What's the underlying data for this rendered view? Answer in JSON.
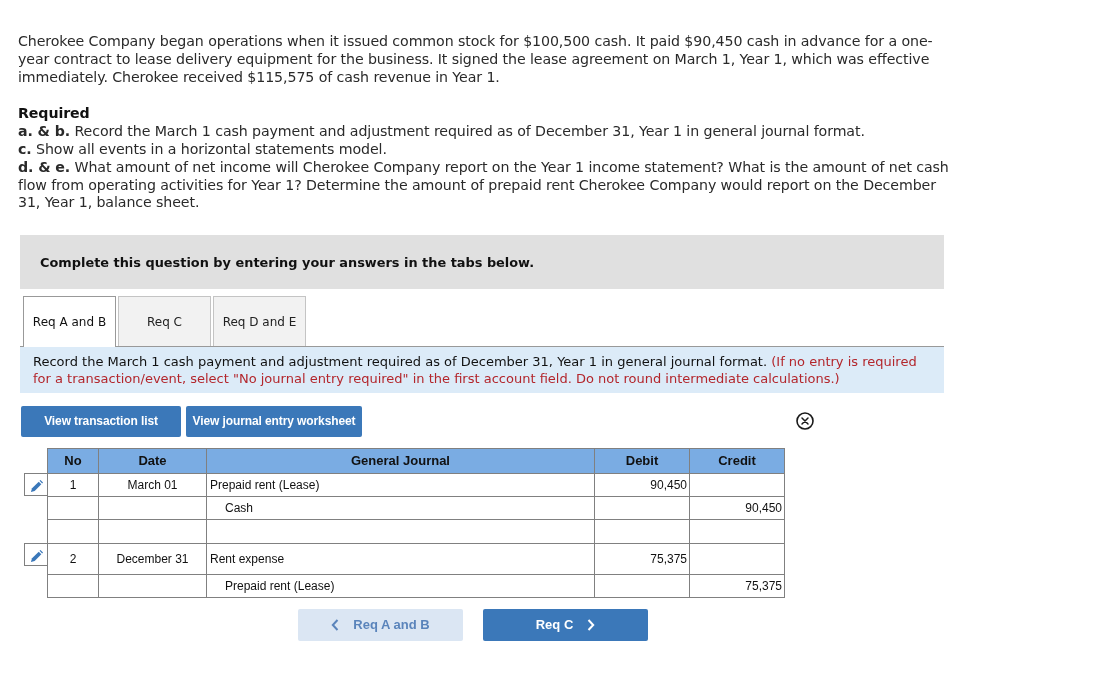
{
  "problem": {
    "intro": "Cherokee Company began operations when it issued common stock for $100,500 cash. It paid $90,450 cash in advance for a one-year contract to lease delivery equipment for the business. It signed the lease agreement on March 1, Year 1, which was effective immediately. Cherokee received $115,575 of cash revenue in Year 1.",
    "required_heading": "Required",
    "requirements": [
      "**a. & b.** Record the March 1 cash payment and adjustment required as of December 31, Year 1 in general journal format.",
      "**c.** Show all events in a horizontal statements model.",
      "**d. & e.** What amount of net income will Cherokee Company report on the Year 1 income statement? What is the amount of net cash flow from operating activities for Year 1? Determine the amount of prepaid rent Cherokee Company would report on the December 31, Year 1, balance sheet."
    ]
  },
  "banner": "Complete this question by entering your answers in the tabs below.",
  "tabs": [
    {
      "label": "Req A and B",
      "selected": true
    },
    {
      "label": "Req C",
      "selected": false
    },
    {
      "label": "Req D and E",
      "selected": false
    }
  ],
  "instructions": {
    "text": "Record the March 1 cash payment and adjustment required as of December 31, Year 1 in general journal format.",
    "note": "(If no entry is required for a transaction/event, select \"No journal entry required\" in the first account field. Do not round intermediate calculations.)"
  },
  "buttons": [
    "View transaction list",
    "View journal entry worksheet"
  ],
  "journal": {
    "columns": [
      "No",
      "Date",
      "General Journal",
      "Debit",
      "Credit"
    ],
    "entries": [
      {
        "no": "1",
        "date": "March 01",
        "lines": [
          {
            "kind": "debit",
            "account": "Prepaid rent (Lease)",
            "amount": "90,450"
          },
          {
            "kind": "credit",
            "account": "Cash",
            "amount": "90,450"
          },
          {
            "kind": "blank"
          }
        ]
      },
      {
        "no": "2",
        "date": "December 31",
        "lines": [
          {
            "kind": "debit",
            "account": "Rent expense",
            "amount": "75,375"
          },
          {
            "kind": "credit",
            "account": "Prepaid rent (Lease)",
            "amount": "75,375"
          }
        ]
      }
    ]
  },
  "navigation": [
    {
      "kind": "prev",
      "label": "Req A and B",
      "disabled": true
    },
    {
      "kind": "next",
      "label": "Req C",
      "disabled": false
    }
  ]
}
